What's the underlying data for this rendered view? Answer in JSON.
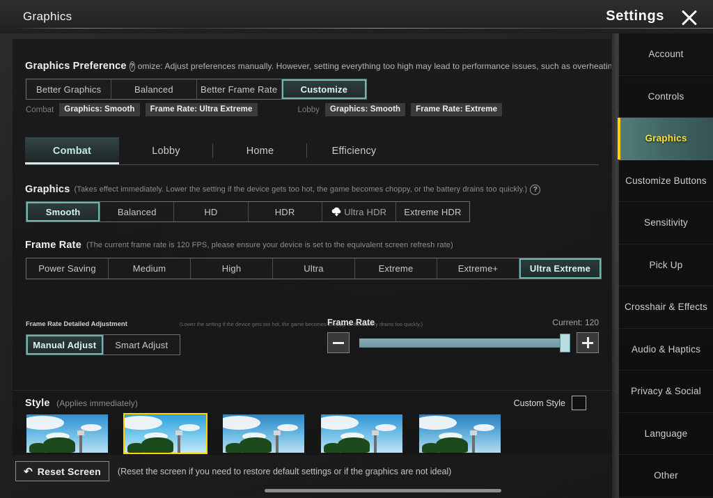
{
  "header": {
    "page_title": "Graphics",
    "settings_label": "Settings",
    "close_icon": "close-icon"
  },
  "sidebar": {
    "items": [
      {
        "label": "Account",
        "active": false
      },
      {
        "label": "Controls",
        "active": false
      },
      {
        "label": "Graphics",
        "active": true
      },
      {
        "label": "Customize Buttons",
        "active": false
      },
      {
        "label": "Sensitivity",
        "active": false
      },
      {
        "label": "Pick Up",
        "active": false
      },
      {
        "label": "Crosshair & Effects",
        "active": false
      },
      {
        "label": "Audio & Haptics",
        "active": false
      },
      {
        "label": "Privacy & Social",
        "active": false
      },
      {
        "label": "Language",
        "active": false
      },
      {
        "label": "Other",
        "active": false
      }
    ]
  },
  "graphics_preference": {
    "title": "Graphics Preference",
    "help_icon": "question-mark-icon",
    "tooltip": "omize: Adjust preferences manually. However, setting everything too high may lead to performance issues, such as overheating, ba",
    "options": [
      {
        "label": "Better Graphics",
        "selected": false
      },
      {
        "label": "Balanced",
        "selected": false
      },
      {
        "label": "Better Frame Rate",
        "selected": false
      },
      {
        "label": "Customize",
        "selected": true
      }
    ],
    "presets": [
      {
        "key": "Combat",
        "chips": [
          "Graphics: Smooth",
          "Frame Rate: Ultra Extreme"
        ]
      },
      {
        "key": "Lobby",
        "chips": [
          "Graphics: Smooth",
          "Frame Rate: Extreme"
        ]
      }
    ]
  },
  "tabs": [
    {
      "label": "Combat",
      "selected": true
    },
    {
      "label": "Lobby",
      "selected": false
    },
    {
      "label": "Home",
      "selected": false
    },
    {
      "label": "Efficiency",
      "selected": false
    }
  ],
  "graphics": {
    "title": "Graphics",
    "note": "(Takes effect immediately. Lower the setting if the device gets too hot, the game becomes choppy, or the battery drains too quickly.)",
    "help_icon": "question-mark-icon",
    "options": [
      {
        "label": "Smooth",
        "selected": true,
        "needs_download": false
      },
      {
        "label": "Balanced",
        "selected": false,
        "needs_download": false
      },
      {
        "label": "HD",
        "selected": false,
        "needs_download": false
      },
      {
        "label": "HDR",
        "selected": false,
        "needs_download": false
      },
      {
        "label": "Ultra HDR",
        "selected": false,
        "needs_download": true,
        "download_icon": "cloud-download-icon"
      },
      {
        "label": "Extreme HDR",
        "selected": false,
        "needs_download": false
      }
    ]
  },
  "frame_rate": {
    "title": "Frame Rate",
    "note": "(The current frame rate is 120 FPS, please ensure your device is set to the equivalent screen refresh rate)",
    "options": [
      {
        "label": "Power Saving",
        "selected": false
      },
      {
        "label": "Medium",
        "selected": false
      },
      {
        "label": "High",
        "selected": false
      },
      {
        "label": "Ultra",
        "selected": false
      },
      {
        "label": "Extreme",
        "selected": false
      },
      {
        "label": "Extreme+",
        "selected": false
      },
      {
        "label": "Ultra Extreme",
        "selected": true
      }
    ]
  },
  "detailed_adjustment": {
    "title": "Frame Rate Detailed Adjustment",
    "note": "(Lower the setting if the device gets too hot, the game becomes choppy, or the battery drains too quickly.)",
    "modes": [
      {
        "label": "Manual Adjust",
        "selected": true
      },
      {
        "label": "Smart Adjust",
        "selected": false
      }
    ],
    "slider": {
      "label": "Frame Rate",
      "current_label": "Current: 120",
      "value": 120,
      "percent": 98,
      "minus_icon": "minus-icon",
      "plus_icon": "plus-icon"
    }
  },
  "style": {
    "title": "Style",
    "note": "(Applies immediately)",
    "custom_style_label": "Custom Style",
    "custom_style_checked": false,
    "thumbnails": [
      {
        "index": 1,
        "selected": false,
        "sky_top": "#2f8fd0",
        "sky_bottom": "#b9dff2"
      },
      {
        "index": 2,
        "selected": true,
        "sky_top": "#2ea2dd",
        "sky_bottom": "#c4e7f6"
      },
      {
        "index": 3,
        "selected": false,
        "sky_top": "#2b86c8",
        "sky_bottom": "#bddef0"
      },
      {
        "index": 4,
        "selected": false,
        "sky_top": "#3094d6",
        "sky_bottom": "#c0e2f3"
      },
      {
        "index": 5,
        "selected": false,
        "sky_top": "#2a7fc0",
        "sky_bottom": "#b4daee"
      }
    ]
  },
  "reset": {
    "button_label": "Reset Screen",
    "icon": "undo-arrow-icon",
    "note": "(Reset the screen if you need to restore default settings or if the graphics are not ideal)"
  },
  "colors": {
    "accent_teal": "#69b8b2",
    "accent_yellow": "#ffd400",
    "panel_bg": "#1a1a1a",
    "text_primary": "#f0f0f0",
    "text_muted": "#8e8e8e"
  }
}
